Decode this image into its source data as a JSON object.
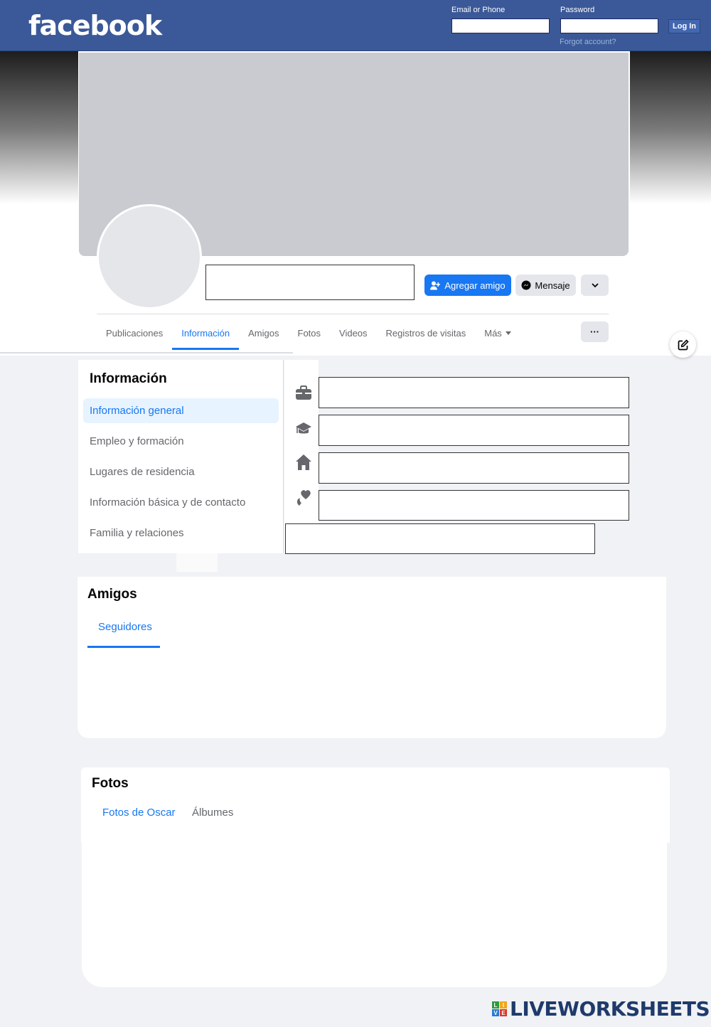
{
  "topbar": {
    "logo": "facebook",
    "email_label": "Email or Phone",
    "password_label": "Password",
    "login_button": "Log In",
    "forgot_link": "Forgot account?"
  },
  "profile": {
    "add_friend": "Agregar amigo",
    "message": "Mensaje",
    "more_dots": "···",
    "tabs": [
      {
        "label": "Publicaciones"
      },
      {
        "label": "Información"
      },
      {
        "label": "Amigos"
      },
      {
        "label": "Fotos"
      },
      {
        "label": "Videos"
      },
      {
        "label": "Registros de visitas"
      },
      {
        "label": "Más"
      }
    ]
  },
  "info": {
    "title": "Información",
    "items": [
      {
        "label": "Información general"
      },
      {
        "label": "Empleo y formación"
      },
      {
        "label": "Lugares de residencia"
      },
      {
        "label": "Información básica y de contacto"
      },
      {
        "label": "Familia y relaciones"
      }
    ],
    "icons": [
      "briefcase-icon",
      "graduation-cap-icon",
      "home-icon",
      "heart-icon"
    ]
  },
  "friends": {
    "title": "Amigos",
    "tab": "Seguidores"
  },
  "photos": {
    "title": "Fotos",
    "tabs": [
      {
        "label": "Fotos de Oscar"
      },
      {
        "label": "Álbumes"
      }
    ]
  },
  "watermark": {
    "text": "LIVEWORKSHEETS",
    "logo_letters": [
      "L",
      "I",
      "V",
      "E"
    ]
  },
  "colors": {
    "topbar": "#3b5998",
    "accent": "#1877f2",
    "page_bg": "#f0f2f5"
  }
}
